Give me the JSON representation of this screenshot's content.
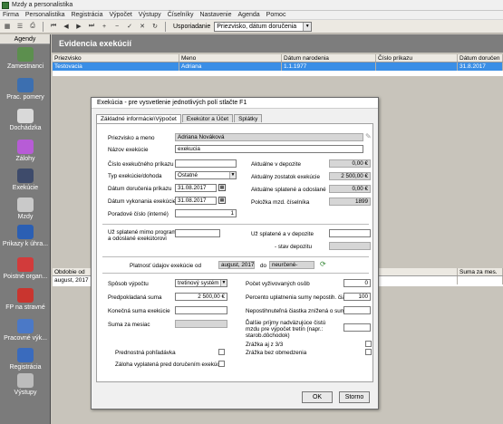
{
  "window": {
    "title": "Mzdy a personalistika"
  },
  "menu": [
    "Firma",
    "Personalistika",
    "Registrácia",
    "Výpočet",
    "Výstupy",
    "Číselníky",
    "Nastavenie",
    "Agenda",
    "Pomoc"
  ],
  "toolbar": {
    "sort_label": "Usporiadanie",
    "sort_value": "Priezvisko, dátum doručenia"
  },
  "sidebar": {
    "header": "Agendy",
    "items": [
      "Zamestnanci",
      "Prac. pomery",
      "Dochádzka",
      "Zálohy",
      "Exekúcie",
      "Mzdy",
      "Prikazy k úhra...",
      "Poistné organ...",
      "FP na stravné",
      "Pracovné výk...",
      "Registrácia",
      "Výstupy"
    ]
  },
  "main": {
    "title": "Evidencia exekúcií",
    "columns": [
      "Priezvisko",
      "Meno",
      "Dátum narodenia",
      "Číslo príkazu",
      "Dátum doručen"
    ],
    "rows": [
      {
        "surname": "Testovacia",
        "name": "Adriana",
        "dob": "1.1.1977",
        "order": "",
        "delivered": "31.8.2017"
      }
    ],
    "lower_columns": [
      "Obdobie od",
      "Suma za mes."
    ],
    "lower_rows": [
      {
        "from": "august, 2017",
        "amount": ""
      }
    ]
  },
  "dialog": {
    "title": "Exekúcia - pre vysvetlenie jednotlivých polí stlačte F1",
    "tabs": [
      "Základné informácie\\Výpočet",
      "Exekútor a Účet",
      "Splátky"
    ],
    "surname_label": "Priezvisko a meno",
    "surname_value": "Adriana Nováková",
    "name_label": "Názov exekúcie",
    "name_value": "exekucia",
    "order_no_label": "Číslo exekučného príkazu",
    "order_no_value": "",
    "type_label": "Typ exekúcie/dohoda",
    "type_value": "Ostatné",
    "delivered_label": "Dátum doručenia príkazu",
    "delivered_value": "31.08.2017",
    "executed_label": "Dátum vykonania exekúcie",
    "executed_value": "31.08.2017",
    "order_seq_label": "Poradové číslo (interné)",
    "order_seq_value": "1",
    "deposit_now_label": "Aktuálne v depozite",
    "deposit_now_value": "0,00 €",
    "balance_label": "Aktuálny zostatok exekúcie",
    "balance_value": "2 500,00 €",
    "paid_label": "Aktuálne splatené a odoslané",
    "paid_value": "0,00 €",
    "item_label": "Položka mzd. číselníka",
    "item_value": "1899",
    "paid_outside_label": "Už splatené mimo programu a odoslané exekútorovi",
    "paid_outside_value": "",
    "paid_deposit_label": "Už splatené a v depozite",
    "paid_deposit_value": "",
    "deposit_state_label": "- stav depozitu",
    "deposit_state_value": "",
    "validity_label": "Platnosť údajov exekúcie od",
    "validity_from": "august, 2017",
    "validity_to_label": "do",
    "validity_to": "neurčené-",
    "calc_label": "Spôsob výpočtu",
    "calc_value": "tretinový systém",
    "expected_label": "Predpokladaná suma",
    "expected_value": "2 500,00 €",
    "final_label": "Konečná suma exekúcie",
    "final_value": "",
    "monthly_label": "Suma za mesiac",
    "monthly_value": "",
    "dependents_label": "Počet vyživovaných osôb",
    "dependents_value": "0",
    "percent_label": "Percento uplatnenia sumy nepostih. čiast.",
    "percent_value": "100",
    "reduced_label": "Nepostihnuteľná čiastka znížená o sumu",
    "reduced_value": "",
    "further_label": "Ďalšie príjmy nadväzujúce čistú mzdu pre výpočet tretín (napr.: starob.dôchodok)",
    "further_value": "",
    "third_label": "Zrážka aj z 3/3",
    "preferred_label": "Prednostná pohľadávka",
    "unlimited_label": "Zrážka bez obmedzenia",
    "advance_label": "Záloha vyplatená pred doručením exekúcie",
    "ok_label": "OK",
    "cancel_label": "Storno"
  }
}
